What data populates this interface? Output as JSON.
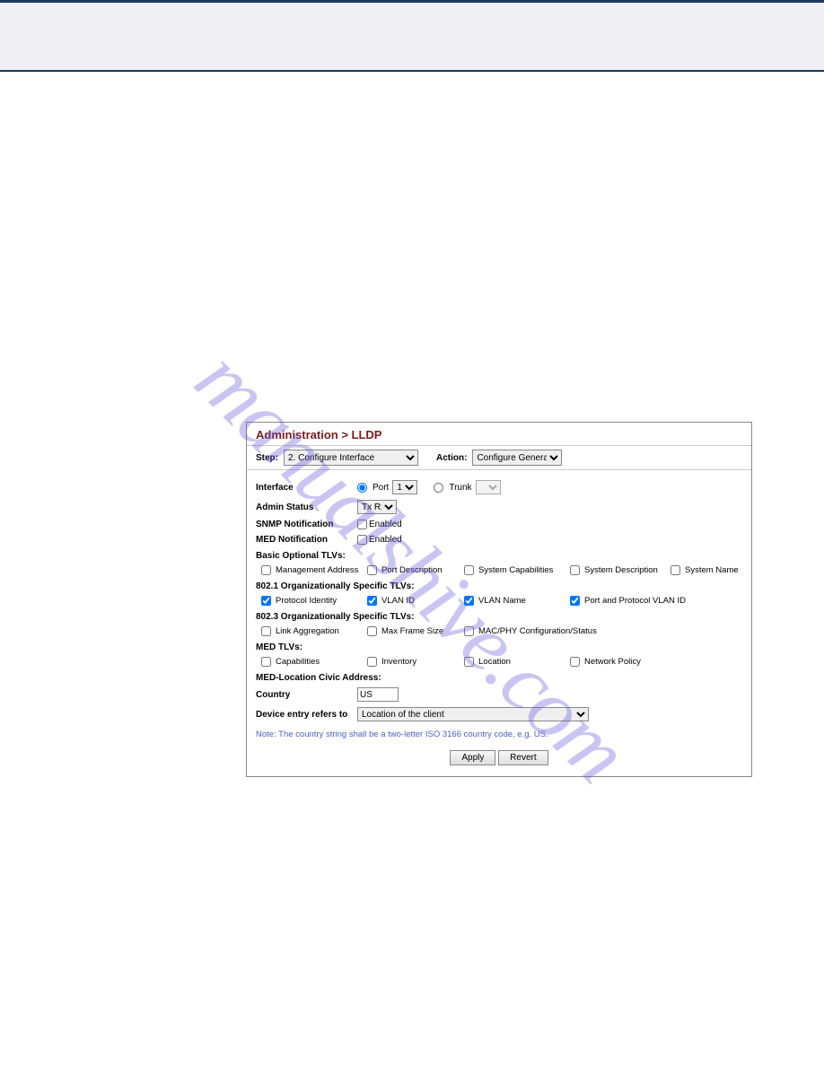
{
  "watermark": "manualshive.com",
  "panel": {
    "title": "Administration > LLDP",
    "step_label": "Step:",
    "step_value": "2. Configure Interface",
    "action_label": "Action:",
    "action_value": "Configure General",
    "interface_label": "Interface",
    "port_label": "Port",
    "port_value": "1",
    "trunk_label": "Trunk",
    "admin_status_label": "Admin Status",
    "admin_status_value": "Tx Rx",
    "snmp_label": "SNMP Notification",
    "snmp_enabled_label": "Enabled",
    "med_notif_label": "MED Notification",
    "med_enabled_label": "Enabled",
    "basic_tlv_heading": "Basic Optional TLVs:",
    "basic": {
      "mgmt_addr": "Management Address",
      "port_desc": "Port Description",
      "sys_cap": "System Capabilities",
      "sys_desc": "System Description",
      "sys_name": "System Name"
    },
    "org8021_heading": "802.1 Organizationally Specific TLVs:",
    "org8021": {
      "proto_id": "Protocol Identity",
      "vlan_id": "VLAN ID",
      "vlan_name": "VLAN Name",
      "port_proto_vlan": "Port and Protocol VLAN ID"
    },
    "org8023_heading": "802.3 Organizationally Specific TLVs:",
    "org8023": {
      "link_agg": "Link Aggregation",
      "max_frame": "Max Frame Size",
      "mac_phy": "MAC/PHY Configuration/Status"
    },
    "med_tlv_heading": "MED TLVs:",
    "med_tlv": {
      "cap": "Capabilities",
      "inv": "Inventory",
      "loc": "Location",
      "net_pol": "Network Policy"
    },
    "med_loc_heading": "MED-Location Civic Address:",
    "country_label": "Country",
    "country_value": "US",
    "device_entry_label": "Device entry refers to",
    "device_entry_value": "Location of the client",
    "note": "Note: The country string shall be a two-letter ISO 3166 country code, e.g. US.",
    "apply_btn": "Apply",
    "revert_btn": "Revert"
  }
}
